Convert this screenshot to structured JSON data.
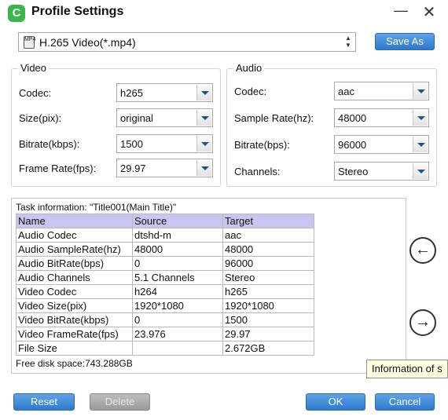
{
  "window": {
    "title": "Profile Settings",
    "minimize_label": "—",
    "close_label": "✕"
  },
  "profile": {
    "icon_text": "MP4",
    "value": "H.265 Video(*.mp4)",
    "save_as_label": "Save As"
  },
  "video": {
    "group_title": "Video",
    "fields": [
      {
        "label": "Codec:",
        "value": "h265"
      },
      {
        "label": "Size(pix):",
        "value": "original"
      },
      {
        "label": "Bitrate(kbps):",
        "value": "1500"
      },
      {
        "label": "Frame Rate(fps):",
        "value": "29.97"
      }
    ]
  },
  "audio": {
    "group_title": "Audio",
    "fields": [
      {
        "label": "Codec:",
        "value": "aac"
      },
      {
        "label": "Sample Rate(hz):",
        "value": "48000"
      },
      {
        "label": "Bitrate(bps):",
        "value": "96000"
      },
      {
        "label": "Channels:",
        "value": "Stereo"
      }
    ]
  },
  "task": {
    "info_label": "Task information: \"Title001(Main Title)\"",
    "headers": [
      "Name",
      "Source",
      "Target"
    ],
    "rows": [
      [
        "Audio Codec",
        "dtshd-m",
        "aac"
      ],
      [
        "Audio SampleRate(hz)",
        "48000",
        "48000"
      ],
      [
        "Audio BitRate(bps)",
        "0",
        "96000"
      ],
      [
        "Audio Channels",
        "5.1 Channels",
        "Stereo"
      ],
      [
        "Video Codec",
        "h264",
        "h265"
      ],
      [
        "Video Size(pix)",
        "1920*1080",
        "1920*1080"
      ],
      [
        "Video BitRate(kbps)",
        "0",
        "1500"
      ],
      [
        "Video FrameRate(fps)",
        "23.976",
        "29.97"
      ],
      [
        "File Size",
        "",
        "2.672GB"
      ]
    ],
    "free_disk_space": "Free disk space:743.288GB"
  },
  "nav": {
    "left_arrow": "←",
    "right_arrow": "→"
  },
  "tooltip": "Information of s",
  "buttons": {
    "reset": "Reset",
    "delete": "Delete",
    "ok": "OK",
    "cancel": "Cancel"
  },
  "colors": {
    "accent_blue": "#2e79cc",
    "table_header": "#c6c6f0",
    "app_icon_green": "#3cb54a",
    "tooltip_bg": "#ffffe1"
  }
}
